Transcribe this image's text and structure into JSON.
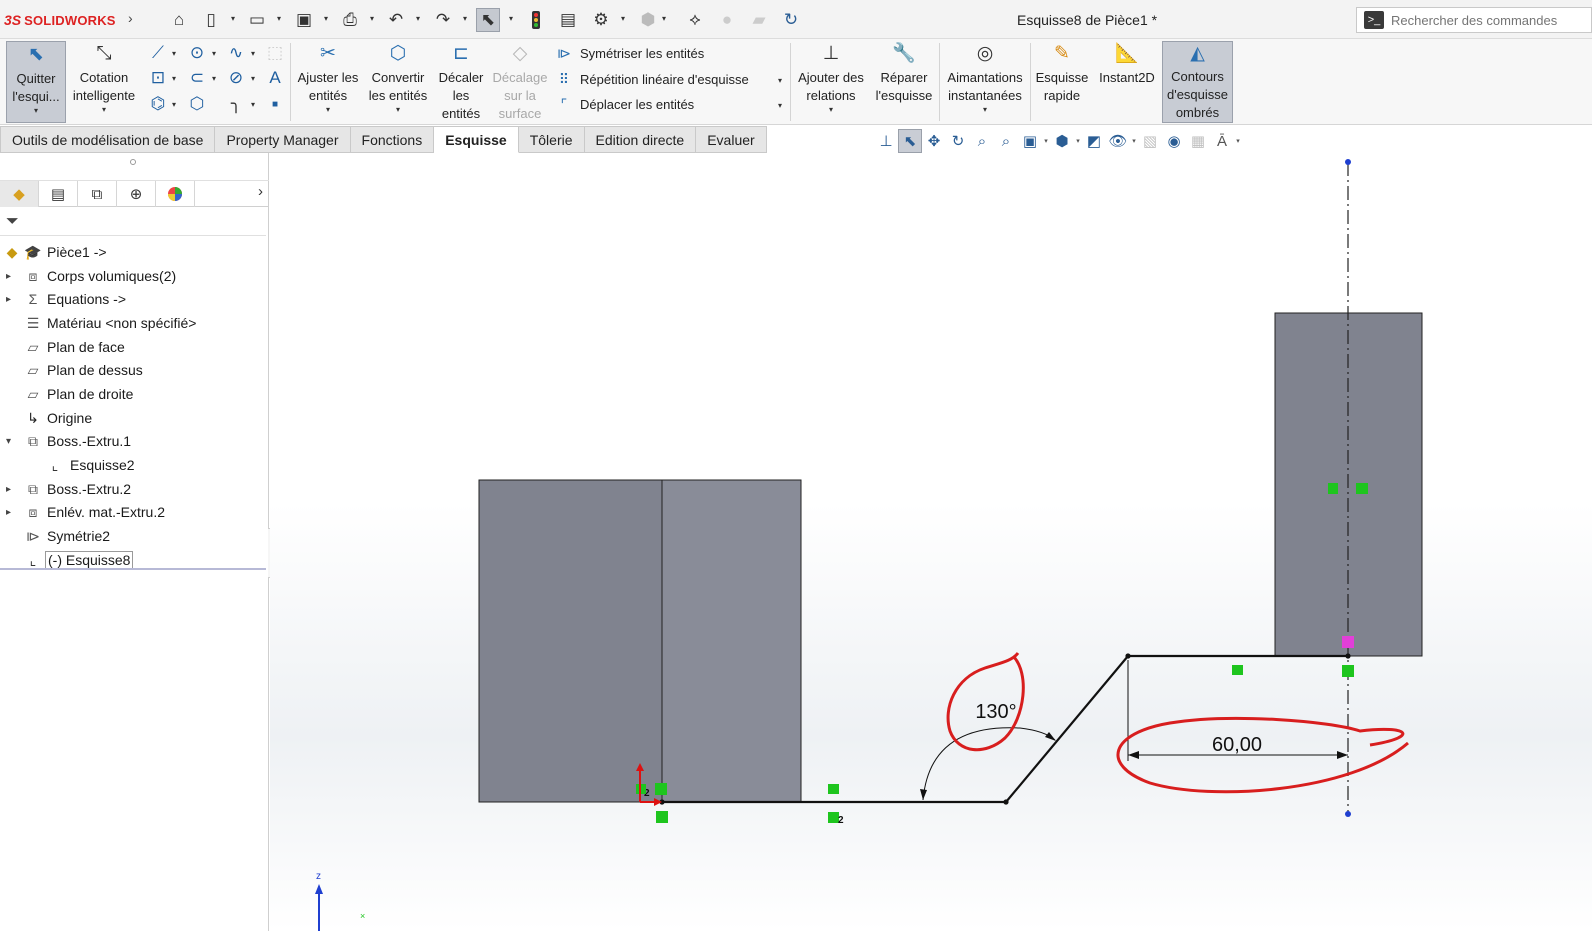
{
  "app": {
    "brand_prefix": "3S",
    "brand_name": "SOLIDWORKS",
    "document_title": "Esquisse8 de Pièce1 *",
    "search_placeholder": "Rechercher des commandes"
  },
  "quick_access": [
    {
      "name": "home-icon",
      "glyph": "⌂"
    },
    {
      "name": "new-document-icon",
      "glyph": "🗋"
    },
    {
      "name": "open-icon",
      "glyph": "📂"
    },
    {
      "name": "save-icon",
      "glyph": "💾"
    },
    {
      "name": "print-icon",
      "glyph": "🖶"
    },
    {
      "name": "undo-icon",
      "glyph": "↶"
    },
    {
      "name": "redo-icon",
      "glyph": "↷"
    },
    {
      "name": "select-icon",
      "glyph": "⬉"
    },
    {
      "name": "rebuild-icon",
      "glyph": "🚦"
    },
    {
      "name": "file-properties-icon",
      "glyph": "▤"
    },
    {
      "name": "options-icon",
      "glyph": "⚙"
    },
    {
      "name": "appearance-icon",
      "glyph": "⬢"
    },
    {
      "name": "measure-icon",
      "glyph": "⟡"
    },
    {
      "name": "render-icon",
      "glyph": "●"
    },
    {
      "name": "section-icon",
      "glyph": "▰"
    },
    {
      "name": "rotate-icon",
      "glyph": "↻"
    }
  ],
  "ribbon": {
    "exit_sketch": {
      "line1": "Quitter",
      "line2": "l'esqui..."
    },
    "smart_dimension": {
      "line1": "Cotation",
      "line2": "intelligente"
    },
    "trim": {
      "line1": "Ajuster les",
      "line2": "entités"
    },
    "convert": {
      "line1": "Convertir",
      "line2": "les entités"
    },
    "offset": {
      "line1": "Décaler",
      "line2": "les",
      "line3": "entités"
    },
    "offset_surface": {
      "line1": "Décalage",
      "line2": "sur la",
      "line3": "surface"
    },
    "mirror": "Symétriser les entités",
    "linear_pattern": "Répétition linéaire d'esquisse",
    "move": "Déplacer les entités",
    "add_relations": {
      "line1": "Ajouter des",
      "line2": "relations"
    },
    "repair": {
      "line1": "Réparer",
      "line2": "l'esquisse"
    },
    "quick_snaps": {
      "line1": "Aimantations",
      "line2": "instantanées"
    },
    "rapid_sketch": {
      "line1": "Esquisse",
      "line2": "rapide"
    },
    "instant2d": {
      "line1": "Instant2D"
    },
    "shaded_contours": {
      "line1": "Contours",
      "line2": "d'esquisse",
      "line3": "ombrés"
    }
  },
  "tabs": [
    {
      "label": "Outils de modélisation de base",
      "active": false
    },
    {
      "label": "Property Manager",
      "active": false
    },
    {
      "label": "Fonctions",
      "active": false
    },
    {
      "label": "Esquisse",
      "active": true
    },
    {
      "label": "Tôlerie",
      "active": false
    },
    {
      "label": "Edition directe",
      "active": false
    },
    {
      "label": "Evaluer",
      "active": false
    }
  ],
  "tree": [
    {
      "label": "Pièce1 ->",
      "icon": "part-icon",
      "expander": ""
    },
    {
      "label": "Corps volumiques(2)",
      "icon": "solid-bodies-icon",
      "expander": "▸"
    },
    {
      "label": "Equations ->",
      "icon": "equations-icon",
      "expander": "▸"
    },
    {
      "label": "Matériau <non spécifié>",
      "icon": "material-icon",
      "expander": ""
    },
    {
      "label": "Plan de face",
      "icon": "plane-icon",
      "expander": ""
    },
    {
      "label": "Plan de dessus",
      "icon": "plane-icon",
      "expander": ""
    },
    {
      "label": "Plan de droite",
      "icon": "plane-icon",
      "expander": ""
    },
    {
      "label": "Origine",
      "icon": "origin-icon",
      "expander": ""
    },
    {
      "label": "Boss.-Extru.1",
      "icon": "extrude-icon",
      "expander": "▾"
    },
    {
      "label": "Esquisse2",
      "icon": "sketch-icon",
      "expander": "",
      "indent": true
    },
    {
      "label": "Boss.-Extru.2",
      "icon": "extrude-icon",
      "expander": "▸"
    },
    {
      "label": "Enlév. mat.-Extru.2",
      "icon": "cut-extrude-icon",
      "expander": "▸"
    },
    {
      "label": "Symétrie2",
      "icon": "mirror-icon",
      "expander": ""
    },
    {
      "label": "(-) Esquisse8",
      "icon": "sketch-icon",
      "expander": "",
      "selected": true
    }
  ],
  "sketch": {
    "angle_dimension": "130°",
    "linear_dimension": "60,00",
    "relation_badges": [
      "2",
      "2"
    ],
    "triad_axis_label": "z"
  },
  "colors": {
    "body_fill": "#80838f",
    "body_fill_light": "#898c98",
    "sketch_line": "#111111",
    "relation_green": "#1ec51e",
    "markup_red": "#d81e1e",
    "centerline_blue": "#1f3fd0"
  }
}
